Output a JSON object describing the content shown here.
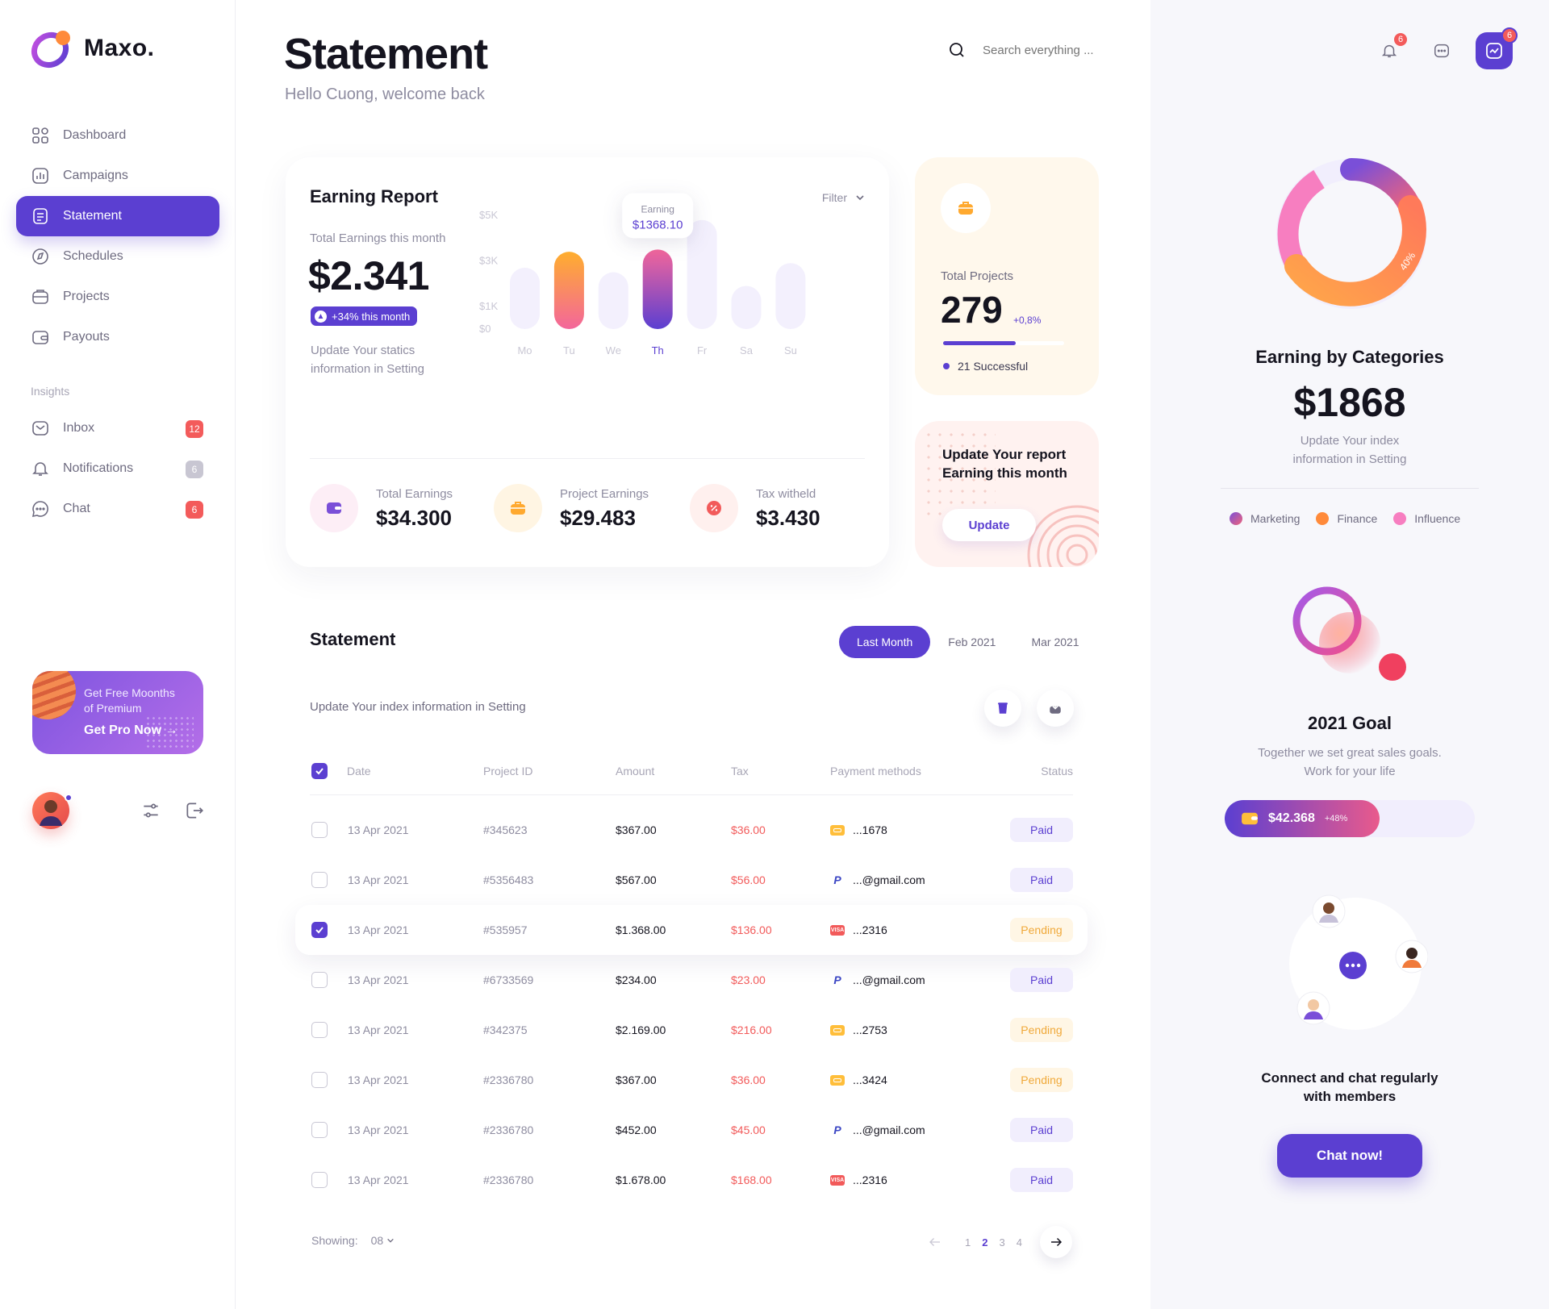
{
  "app": {
    "name": "Maxo."
  },
  "colors": {
    "accent": "#5b3fd1",
    "danger": "#f25a5a",
    "warning": "#f0a93a",
    "orange": "#ff9f3a",
    "pink": "#f3669b"
  },
  "sidebar": {
    "items": [
      {
        "label": "Dashboard",
        "icon": "dashboard-icon"
      },
      {
        "label": "Campaigns",
        "icon": "chart-icon"
      },
      {
        "label": "Statement",
        "icon": "document-icon",
        "active": true
      },
      {
        "label": "Schedules",
        "icon": "compass-icon"
      },
      {
        "label": "Projects",
        "icon": "folder-icon"
      },
      {
        "label": "Payouts",
        "icon": "wallet-icon"
      }
    ],
    "section_label": "Insights",
    "insights": [
      {
        "label": "Inbox",
        "icon": "mail-icon",
        "badge": "12"
      },
      {
        "label": "Notifications",
        "icon": "bell-icon",
        "badge": "6"
      },
      {
        "label": "Chat",
        "icon": "chat-icon",
        "badge": "6"
      }
    ],
    "promo": {
      "line1": "Get Free Moonths",
      "line2": "of Premium",
      "cta": "Get Pro Now"
    }
  },
  "header": {
    "title": "Statement",
    "subtitle": "Hello Cuong, welcome back",
    "search_placeholder": "Search everything ...",
    "notif_badge": "6",
    "trend_badge": "6"
  },
  "earning_report": {
    "title": "Earning Report",
    "filter": "Filter",
    "total_label": "Total Earnings this month",
    "total_value": "$2.341",
    "delta": "+34% this month",
    "note": "Update Your statics information in Setting",
    "tooltip_label": "Earning",
    "tooltip_value": "$1368.10",
    "stats": [
      {
        "label": "Total Earnings",
        "value": "$34.300",
        "icon": "wallet-icon"
      },
      {
        "label": "Project Earnings",
        "value": "$29.483",
        "icon": "briefcase-icon"
      },
      {
        "label": "Tax witheld",
        "value": "$3.430",
        "icon": "percent-icon"
      }
    ]
  },
  "chart_data": {
    "type": "bar",
    "categories": [
      "Mo",
      "Tu",
      "We",
      "Th",
      "Fr",
      "Sa",
      "Su"
    ],
    "values": [
      2700,
      3400,
      2500,
      3500,
      4800,
      1900,
      2900
    ],
    "highlighted": [
      "Tu",
      "Th"
    ],
    "y_ticks": [
      "$5K",
      "$3K",
      "$1K",
      "$0"
    ],
    "ylim": [
      0,
      5500
    ]
  },
  "projects_card": {
    "label": "Total Projects",
    "value": "279",
    "delta": "+0,8%",
    "progress": 0.6,
    "success": "21 Successful"
  },
  "update_card": {
    "title": "Update Your report Earning this month",
    "button": "Update"
  },
  "statement": {
    "title": "Statement",
    "tabs": [
      "Last Month",
      "Feb 2021",
      "Mar 2021"
    ],
    "note": "Update Your index information in Setting",
    "columns": [
      "Date",
      "Project ID",
      "Amount",
      "Tax",
      "Payment methods",
      "Status"
    ],
    "rows": [
      {
        "date": "13 Apr 2021",
        "pid": "#345623",
        "amount": "$367.00",
        "tax": "$36.00",
        "method": "card",
        "account": "...1678",
        "status": "Paid",
        "checked": false
      },
      {
        "date": "13 Apr 2021",
        "pid": "#5356483",
        "amount": "$567.00",
        "tax": "$56.00",
        "method": "paypal",
        "account": "...@gmail.com",
        "status": "Paid",
        "checked": false
      },
      {
        "date": "13 Apr 2021",
        "pid": "#535957",
        "amount": "$1.368.00",
        "tax": "$136.00",
        "method": "visa",
        "account": "...2316",
        "status": "Pending",
        "checked": true
      },
      {
        "date": "13 Apr 2021",
        "pid": "#6733569",
        "amount": "$234.00",
        "tax": "$23.00",
        "method": "paypal",
        "account": "...@gmail.com",
        "status": "Paid",
        "checked": false
      },
      {
        "date": "13 Apr 2021",
        "pid": "#342375",
        "amount": "$2.169.00",
        "tax": "$216.00",
        "method": "card",
        "account": "...2753",
        "status": "Pending",
        "checked": false
      },
      {
        "date": "13 Apr 2021",
        "pid": "#2336780",
        "amount": "$367.00",
        "tax": "$36.00",
        "method": "card",
        "account": "...3424",
        "status": "Pending",
        "checked": false
      },
      {
        "date": "13 Apr 2021",
        "pid": "#2336780",
        "amount": "$452.00",
        "tax": "$45.00",
        "method": "paypal",
        "account": "...@gmail.com",
        "status": "Paid",
        "checked": false
      },
      {
        "date": "13 Apr 2021",
        "pid": "#2336780",
        "amount": "$1.678.00",
        "tax": "$168.00",
        "method": "visa",
        "account": "...2316",
        "status": "Paid",
        "checked": false
      }
    ],
    "showing_label": "Showing:",
    "showing_value": "08",
    "pages": [
      "1",
      "2",
      "3",
      "4"
    ],
    "active_page": "2"
  },
  "categories": {
    "title": "Earning by Categories",
    "value": "$1868",
    "note": "Update Your index information in Setting",
    "segment_label": "40%",
    "legend": [
      {
        "name": "Marketing",
        "color": "#7a4fd8"
      },
      {
        "name": "Finance",
        "color": "#ff8a3a"
      },
      {
        "name": "Influence",
        "color": "#f77ec0"
      }
    ]
  },
  "goal": {
    "title": "2021 Goal",
    "note": "Together we set great sales goals. Work for your life",
    "amount": "$42.368",
    "delta": "+48%",
    "progress": 0.62
  },
  "chat_card": {
    "title": "Connect and chat regularly with members",
    "button": "Chat now!"
  }
}
